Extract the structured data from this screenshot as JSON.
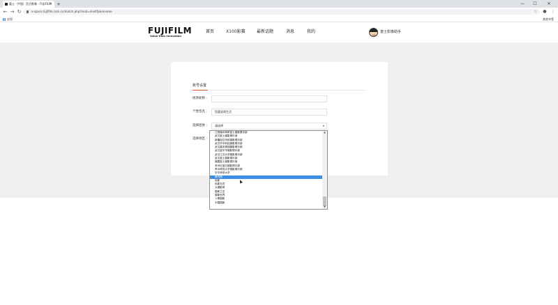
{
  "browser": {
    "tab_title": "富士（中国）官方影像 - FUJIFILM",
    "tab_close": "×",
    "new_tab": "+",
    "url": "x-space.fujifilm.com.cn/match.php?mod=modify&rename",
    "apps_label": "应用",
    "other_bookmarks": "其他书签",
    "back": "←",
    "forward": "→",
    "reload": "↻",
    "home": "⌂",
    "star": "☆",
    "menu": "⋮",
    "minimize": "—",
    "maximize": "☐",
    "close": "✕"
  },
  "header": {
    "logo_text": "FUJIFILM",
    "logo_tagline": "Value from Innovation",
    "nav": [
      "首页",
      "X100影赛",
      "最新话题",
      "消息",
      "我的"
    ],
    "user_name": "富士影像助手"
  },
  "form": {
    "section_title": "账号设置",
    "nickname_label": "修改昵称 :",
    "nickname_value": "",
    "signature_label": "个性签名 :",
    "signature_value": "您要说两生活",
    "club_label": "选择团体 :",
    "club_value": "请选择",
    "region_label": "选择地区 :"
  },
  "dropdown": {
    "options": [
      "江西赣州林帆富士摄影俱乐部",
      "武汉富士摄影俱乐部",
      "新疆克拉玛依摄影俱乐部",
      "武汉华中科技摄影俱乐部",
      "武汉重庆俱团摄影俱乐部",
      "武汉金华市摄影俱乐部",
      "武汉江汉大学摄影俱乐部",
      "武汉富士摄影俱乐部",
      "福建富士摄影俱乐部",
      "贵州红蓝白摄影俱乐部",
      "贵州师范大学摄影俱乐部",
      "华中师范大学",
      "蜂鸟网",
      "色影",
      "色影无忌",
      "大摄影网",
      "摄影之友",
      "摄影世界",
      "人像摄影",
      "中国摄影"
    ],
    "selected_index": 12,
    "scroll_up": "▲",
    "scroll_down": "▼"
  }
}
